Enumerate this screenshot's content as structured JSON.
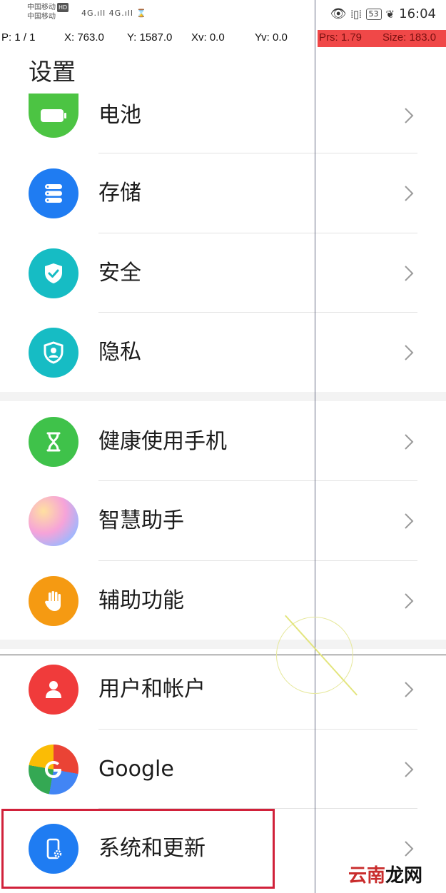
{
  "status_bar": {
    "carrier_1": "中国移动",
    "carrier_hd": "HD",
    "carrier_2": "中国移动",
    "signal_text": "4G.ıll 4G.ıll ⌛",
    "battery": "53",
    "time": "16:04"
  },
  "pointer_overlay": {
    "p": "P: 1 / 1",
    "x": "X: 763.0",
    "y": "Y: 1587.0",
    "xv": "Xv: 0.0",
    "yv": "Yv: 0.0",
    "prs": "Prs: 1.79",
    "size": "Size: 183.0"
  },
  "page": {
    "title": "设置"
  },
  "settings_items": [
    {
      "label": "电池",
      "icon": "battery-icon",
      "color": "#4cc443"
    },
    {
      "label": "存储",
      "icon": "storage-icon",
      "color": "#1f7cf2"
    },
    {
      "label": "安全",
      "icon": "shield-check-icon",
      "color": "#16bcc4"
    },
    {
      "label": "隐私",
      "icon": "privacy-icon",
      "color": "#16bcc4"
    },
    {
      "label": "健康使用手机",
      "icon": "hourglass-icon",
      "color": "#3fc24a"
    },
    {
      "label": "智慧助手",
      "icon": "assistant-orb-icon",
      "color": "#f0a3d8"
    },
    {
      "label": "辅助功能",
      "icon": "hand-icon",
      "color": "#f59a12"
    },
    {
      "label": "用户和帐户",
      "icon": "user-icon",
      "color": "#f03b3b"
    },
    {
      "label": "Google",
      "icon": "google-icon",
      "color": "#4285f4"
    },
    {
      "label": "系统和更新",
      "icon": "system-update-icon",
      "color": "#1f7cf2"
    }
  ],
  "watermark": {
    "text_red": "云南",
    "text_black": "龙网"
  }
}
